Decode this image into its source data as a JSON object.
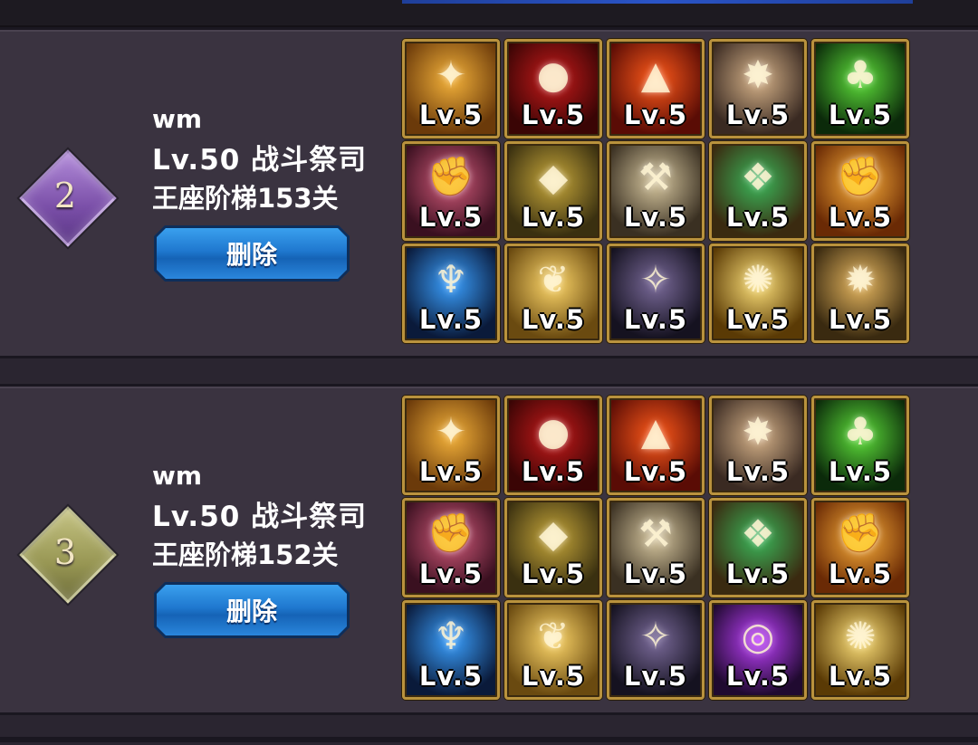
{
  "entries": [
    {
      "rank": "2",
      "rank_color": "#8a5fb7",
      "name": "wm",
      "info": "Lv.50 战斗祭司",
      "stage": "王座阶梯153关",
      "delete_label": "删除",
      "skills": [
        {
          "level": "Lv.5",
          "icon": "golden-rune-icon",
          "bg": [
            "#f4b23a",
            "#6b3a0a"
          ],
          "glyph": "✦"
        },
        {
          "level": "Lv.5",
          "icon": "blood-orb-icon",
          "bg": [
            "#c81a1a",
            "#3a0505"
          ],
          "glyph": "●"
        },
        {
          "level": "Lv.5",
          "icon": "flame-wings-icon",
          "bg": [
            "#ff5a1a",
            "#5a0c05"
          ],
          "glyph": "▲"
        },
        {
          "level": "Lv.5",
          "icon": "star-burst-icon",
          "bg": [
            "#d8b48a",
            "#3a2a22"
          ],
          "glyph": "✸"
        },
        {
          "level": "Lv.5",
          "icon": "green-flame-icon",
          "bg": [
            "#5ee03a",
            "#0b2a0a"
          ],
          "glyph": "♣"
        },
        {
          "level": "Lv.5",
          "icon": "crimson-fist-icon",
          "bg": [
            "#d45a7a",
            "#3a1020"
          ],
          "glyph": "✊"
        },
        {
          "level": "Lv.5",
          "icon": "golden-shield-icon",
          "bg": [
            "#c8a83a",
            "#3a3010"
          ],
          "glyph": "◆"
        },
        {
          "level": "Lv.5",
          "icon": "silver-hammer-icon",
          "bg": [
            "#d8c8a0",
            "#3a3022"
          ],
          "glyph": "⚒"
        },
        {
          "level": "Lv.5",
          "icon": "emerald-vine-icon",
          "bg": [
            "#3ab85a",
            "#3a2a10"
          ],
          "glyph": "❖"
        },
        {
          "level": "Lv.5",
          "icon": "golden-fist-icon",
          "bg": [
            "#ffb23a",
            "#6a2a05"
          ],
          "glyph": "✊"
        },
        {
          "level": "Lv.5",
          "icon": "blue-spirit-icon",
          "bg": [
            "#3aa0ff",
            "#0a1a3a"
          ],
          "glyph": "♆"
        },
        {
          "level": "Lv.5",
          "icon": "holy-wings-icon",
          "bg": [
            "#ffd86a",
            "#6a4a10"
          ],
          "glyph": "❦"
        },
        {
          "level": "Lv.5",
          "icon": "shadow-dancer-icon",
          "bg": [
            "#7a6a9a",
            "#151220"
          ],
          "glyph": "✧"
        },
        {
          "level": "Lv.5",
          "icon": "radiant-burst-icon",
          "bg": [
            "#ffe27a",
            "#5a3a05"
          ],
          "glyph": "✺"
        },
        {
          "level": "Lv.5",
          "icon": "compass-star-icon",
          "bg": [
            "#e8b860",
            "#3a2a10"
          ],
          "glyph": "✹"
        }
      ]
    },
    {
      "rank": "3",
      "rank_color": "#9a9a55",
      "name": "wm",
      "info": "Lv.50 战斗祭司",
      "stage": "王座阶梯152关",
      "delete_label": "删除",
      "skills": [
        {
          "level": "Lv.5",
          "icon": "golden-rune-icon",
          "bg": [
            "#f4b23a",
            "#6b3a0a"
          ],
          "glyph": "✦"
        },
        {
          "level": "Lv.5",
          "icon": "blood-orb-icon",
          "bg": [
            "#c81a1a",
            "#3a0505"
          ],
          "glyph": "●"
        },
        {
          "level": "Lv.5",
          "icon": "flame-wings-icon",
          "bg": [
            "#ff5a1a",
            "#5a0c05"
          ],
          "glyph": "▲"
        },
        {
          "level": "Lv.5",
          "icon": "star-burst-icon",
          "bg": [
            "#d8b48a",
            "#3a2a22"
          ],
          "glyph": "✸"
        },
        {
          "level": "Lv.5",
          "icon": "green-flame-icon",
          "bg": [
            "#5ee03a",
            "#0b2a0a"
          ],
          "glyph": "♣"
        },
        {
          "level": "Lv.5",
          "icon": "crimson-fist-icon",
          "bg": [
            "#d45a7a",
            "#3a1020"
          ],
          "glyph": "✊"
        },
        {
          "level": "Lv.5",
          "icon": "golden-shield-icon",
          "bg": [
            "#c8a83a",
            "#3a3010"
          ],
          "glyph": "◆"
        },
        {
          "level": "Lv.5",
          "icon": "silver-hammer-icon",
          "bg": [
            "#d8c8a0",
            "#3a3022"
          ],
          "glyph": "⚒"
        },
        {
          "level": "Lv.5",
          "icon": "emerald-vine-icon",
          "bg": [
            "#3ab85a",
            "#3a2a10"
          ],
          "glyph": "❖"
        },
        {
          "level": "Lv.5",
          "icon": "golden-fist-icon",
          "bg": [
            "#ffb23a",
            "#6a2a05"
          ],
          "glyph": "✊"
        },
        {
          "level": "Lv.5",
          "icon": "blue-spirit-icon",
          "bg": [
            "#3aa0ff",
            "#0a1a3a"
          ],
          "glyph": "♆"
        },
        {
          "level": "Lv.5",
          "icon": "holy-wings-icon",
          "bg": [
            "#ffd86a",
            "#6a4a10"
          ],
          "glyph": "❦"
        },
        {
          "level": "Lv.5",
          "icon": "shadow-dancer-icon",
          "bg": [
            "#7a6a9a",
            "#151220"
          ],
          "glyph": "✧"
        },
        {
          "level": "Lv.5",
          "icon": "purple-vortex-icon",
          "bg": [
            "#c040ff",
            "#200a30"
          ],
          "glyph": "◎"
        },
        {
          "level": "Lv.5",
          "icon": "radiant-burst-icon",
          "bg": [
            "#ffe27a",
            "#5a3a05"
          ],
          "glyph": "✺"
        }
      ]
    }
  ]
}
